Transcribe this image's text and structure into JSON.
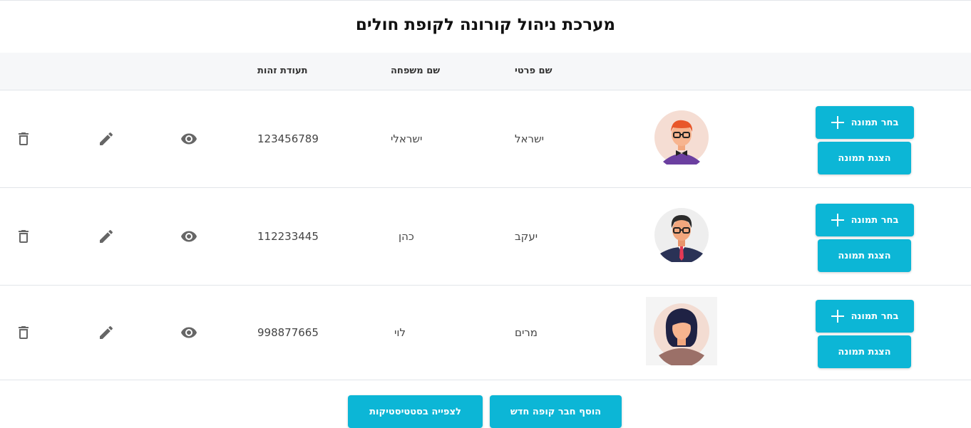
{
  "page": {
    "title": "מערכת ניהול קורונה לקופת חולים"
  },
  "table": {
    "headers": {
      "first_name": "שם פרטי",
      "last_name": "שם משפחה",
      "id": "תעודת זהות"
    },
    "rows": [
      {
        "first_name": "ישראל",
        "last_name": "ישראלי",
        "id": "123456789",
        "avatar": "avatar-redhead-man-bowtie"
      },
      {
        "first_name": "יעקב",
        "last_name": "כהן",
        "id": "112233445",
        "avatar": "avatar-man-suit-tie"
      },
      {
        "first_name": "מרים",
        "last_name": "לוי",
        "id": "998877665",
        "avatar": "avatar-woman-dark-hair"
      }
    ],
    "row_buttons": {
      "choose_image": "בחר תמונה",
      "show_image": "הצגת תמונה"
    },
    "row_icons": {
      "view": "eye-icon",
      "edit": "pencil-icon",
      "delete": "trash-icon"
    }
  },
  "footer": {
    "add_member": "הוסף חבר קופה חדש",
    "view_stats": "לצפייה בסטטיסטיקות"
  },
  "colors": {
    "accent": "#0cb6d6",
    "header_bg": "#f6f7f9",
    "icon": "#666666"
  }
}
